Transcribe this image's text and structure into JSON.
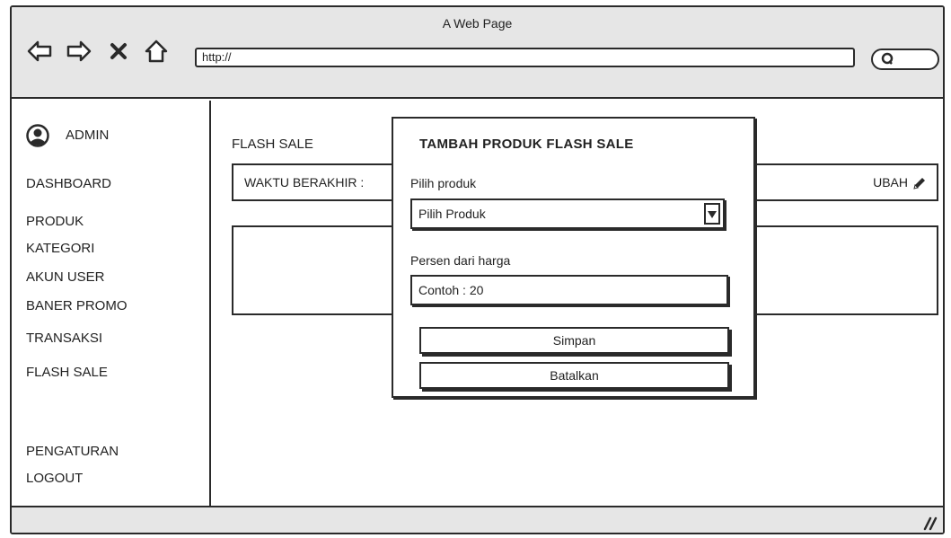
{
  "window": {
    "title": "A Web Page"
  },
  "browser": {
    "url": "http://",
    "icons": [
      "back-arrow-icon",
      "forward-arrow-icon",
      "close-x-icon",
      "home-icon",
      "search-icon"
    ]
  },
  "sidebar": {
    "user_label": "ADMIN",
    "menu": {
      "dashboard": "DASHBOARD",
      "produk": "PRODUK",
      "kategori": "KATEGORI",
      "akun_user": "AKUN USER",
      "baner_promo": "BANER PROMO",
      "transaksi": "TRANSAKSI",
      "flash_sale": "FLASH SALE",
      "pengaturan": "PENGATURAN",
      "logout": "LOGOUT"
    }
  },
  "main": {
    "title": "FLASH SALE",
    "end_time_label": "WAKTU BERAKHIR :",
    "edit_label": "UBAH"
  },
  "modal": {
    "title": "TAMBAH PRODUK FLASH SALE",
    "product_label": "Pilih produk",
    "product_select_value": "Pilih Produk",
    "percent_label": "Persen dari harga",
    "percent_placeholder": "Contoh : 20",
    "save_label": "Simpan",
    "cancel_label": "Batalkan"
  },
  "colors": {
    "line": "#2a2a2a",
    "chrome": "#e6e6e6",
    "background": "#ffffff"
  }
}
